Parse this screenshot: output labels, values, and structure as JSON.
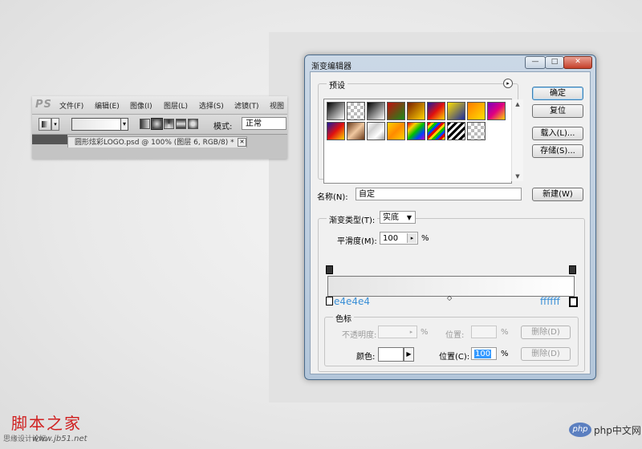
{
  "photoshop": {
    "logo": "PS",
    "menu": [
      "文件(F)",
      "编辑(E)",
      "图像(I)",
      "图层(L)",
      "选择(S)",
      "滤镜(T)",
      "视图"
    ],
    "mode_label": "模式:",
    "mode_value": "正常",
    "document_tab": "圆形炫彩LOGO.psd @ 100% (图层 6, RGB/8) *",
    "tab_close": "✕"
  },
  "dialog": {
    "title": "渐变编辑器",
    "window_buttons": {
      "minimize": "—",
      "maximize": "□",
      "close": "✕"
    },
    "presets": {
      "group_label": "预设",
      "menu_icon": "▸",
      "swatches": [
        "linear-gradient(135deg,#000,#fff)",
        "repeating-conic-gradient(#bbb 0 25%,#fff 0 50%) 0 0/8px 8px",
        "linear-gradient(135deg,#000,#ffffff)",
        "linear-gradient(135deg,#c01010,#1a8a1a)",
        "linear-gradient(135deg,#7a1f00,#ffd400)",
        "linear-gradient(135deg,#1a1aa0,#e01010,#ffd400)",
        "linear-gradient(135deg,#ffe000,#1a2aa0)",
        "linear-gradient(135deg,#ff7a00,#ffe000)",
        "linear-gradient(135deg,#7a00c0,#e00080,#ffd400)",
        "linear-gradient(135deg,#1a1aa0,#e01010,#ffd400)",
        "linear-gradient(135deg,#6a3a1a,#f0c8a0,#6a3a1a)",
        "linear-gradient(135deg,#ffffff,#cfcfcf,#ffffff,#a0a0a0)",
        "linear-gradient(135deg,#ffd000,#ff8a00,#ffd000)",
        "linear-gradient(135deg,#e00000,#ffd000,#00c000,#0040ff,#c000c0)",
        "repeating-linear-gradient(135deg,#e00000 0 3px,#ffd000 3px 6px,#00c000 6px 9px,#0040ff 9px 12px)",
        "repeating-linear-gradient(135deg,#000 0 3px,#fff 3px 6px)",
        "repeating-conic-gradient(#bbb 0 25%,#fff 0 50%) 0 0/8px 8px"
      ]
    },
    "buttons": {
      "ok": "确定",
      "reset": "复位",
      "load": "载入(L)...",
      "save": "存储(S)...",
      "new": "新建(W)"
    },
    "name_label": "名称(N):",
    "name_value": "自定",
    "gradient_type_label": "渐变类型(T):",
    "gradient_type_value": "实底",
    "smoothness_label": "平滑度(M):",
    "smoothness_value": "100",
    "smoothness_unit": "%",
    "stop_left_hex": "e4e4e4",
    "stop_right_hex": "ffffff",
    "colors": {
      "left": "#e4e4e4",
      "right": "#ffffff",
      "accent": "#3a8fd6"
    },
    "stops": {
      "group_label": "色标",
      "opacity_label": "不透明度:",
      "opacity_unit": "%",
      "opacity_location_label": "位置:",
      "opacity_location_unit": "%",
      "delete_opacity": "删除(D)",
      "color_label": "颜色:",
      "color_location_label": "位置(C):",
      "color_location_value": "100",
      "color_location_unit": "%",
      "delete_color": "删除(D)"
    }
  },
  "watermark": {
    "left_brand": "脚本之家",
    "left_sub": "思缘设计论坛",
    "left_url": "www.jb51.net",
    "right_brand": "php中文网",
    "right_logo": "php"
  }
}
